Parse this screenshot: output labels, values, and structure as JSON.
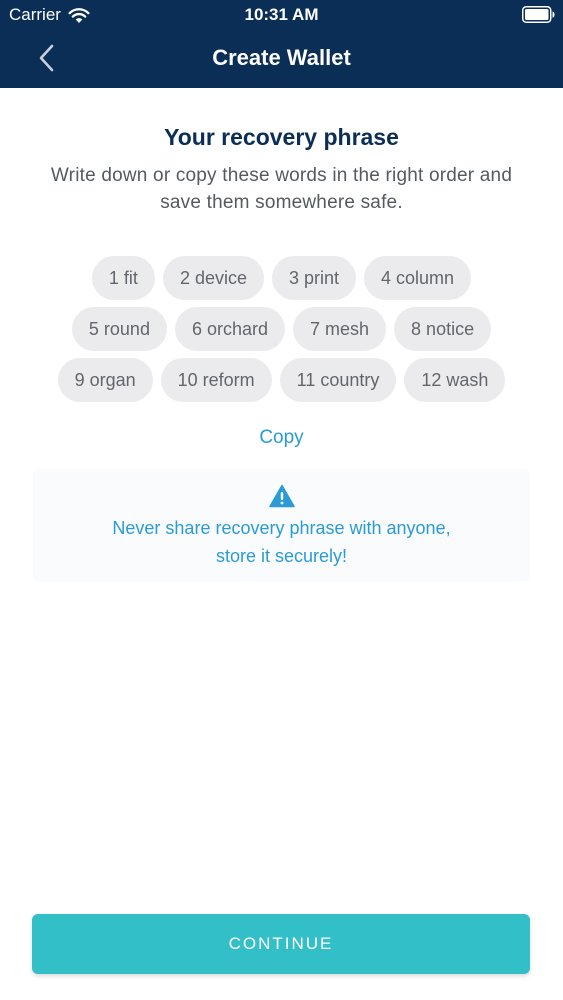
{
  "status_bar": {
    "carrier": "Carrier",
    "time": "10:31 AM",
    "wifi_icon": "wifi-icon",
    "battery_icon": "battery-icon"
  },
  "nav": {
    "title": "Create Wallet",
    "back_icon": "chevron-left-icon"
  },
  "main": {
    "heading": "Your recovery phrase",
    "subtitle": "Write down or copy these words in the right order and save them somewhere safe.",
    "words": [
      "1 fit",
      "2 device",
      "3 print",
      "4 column",
      "5 round",
      "6 orchard",
      "7 mesh",
      "8 notice",
      "9 organ",
      "10 reform",
      "11 country",
      "12 wash"
    ],
    "copy_label": "Copy",
    "warning": {
      "icon": "warning-triangle-icon",
      "line1": "Never share recovery phrase with anyone,",
      "line2": "store it securely!"
    },
    "continue_label": "CONTINUE"
  },
  "colors": {
    "header_bg": "#0b2e57",
    "heading": "#0b2e57",
    "accent_blue": "#2a9bd6",
    "chip_bg": "#ebebed",
    "button_bg": "#33bfc7"
  }
}
